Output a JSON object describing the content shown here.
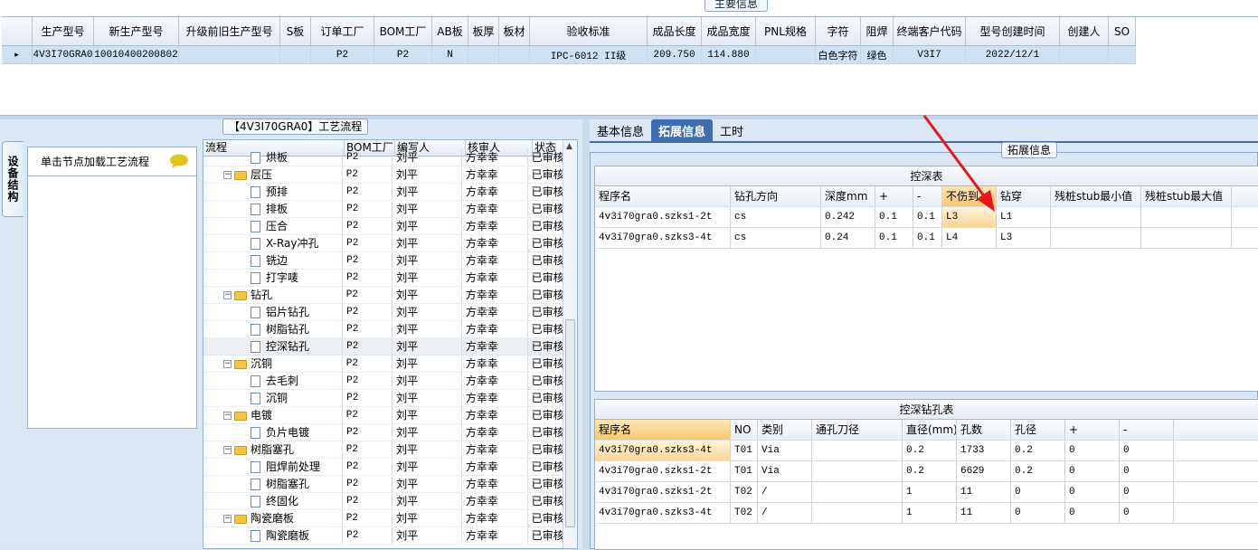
{
  "main_panel": {
    "title": "主要信息",
    "columns": [
      "生产型号",
      "新生产型号",
      "升级前旧生产型号",
      "S板",
      "订单工厂",
      "BOM工厂",
      "AB板",
      "板厚",
      "板材",
      "验收标准",
      "成品长度",
      "成品宽度",
      "PNL规格",
      "字符",
      "阻焊",
      "终端客户代码",
      "型号创建时间",
      "创建人",
      "SO"
    ],
    "row": [
      "4V3I70GRA0",
      "10010400200802",
      "",
      "",
      "P2",
      "P2",
      "N",
      "",
      "",
      "IPC-6012 II级",
      "209.750",
      "114.880",
      "",
      "白色字符",
      "绿色",
      "V3I7",
      "2022/12/1",
      "",
      ""
    ]
  },
  "left_panel": {
    "side_tab": "设备结构",
    "node_hint": "单击节点加载工艺流程",
    "process_title": "【4V3I70GRA0】工艺流程",
    "tree_columns": [
      "流程",
      "BOM工厂",
      "编写人",
      "核审人",
      "状态"
    ],
    "tree_rows": [
      {
        "name": "烘板",
        "level": 2,
        "factory": "P2",
        "writer": "刘平",
        "reviewer": "方幸幸",
        "status": "已审核"
      },
      {
        "name": "层压",
        "level": 1,
        "factory": "P2",
        "writer": "刘平",
        "reviewer": "方幸幸",
        "status": "已审核"
      },
      {
        "name": "预排",
        "level": 2,
        "factory": "P2",
        "writer": "刘平",
        "reviewer": "方幸幸",
        "status": "已审核"
      },
      {
        "name": "排板",
        "level": 2,
        "factory": "P2",
        "writer": "刘平",
        "reviewer": "方幸幸",
        "status": "已审核"
      },
      {
        "name": "压合",
        "level": 2,
        "factory": "P2",
        "writer": "刘平",
        "reviewer": "方幸幸",
        "status": "已审核"
      },
      {
        "name": "X-Ray冲孔",
        "level": 2,
        "factory": "P2",
        "writer": "刘平",
        "reviewer": "方幸幸",
        "status": "已审核"
      },
      {
        "name": "铣边",
        "level": 2,
        "factory": "P2",
        "writer": "刘平",
        "reviewer": "方幸幸",
        "status": "已审核"
      },
      {
        "name": "打字唛",
        "level": 2,
        "factory": "P2",
        "writer": "刘平",
        "reviewer": "方幸幸",
        "status": "已审核"
      },
      {
        "name": "钻孔",
        "level": 1,
        "factory": "P2",
        "writer": "刘平",
        "reviewer": "方幸幸",
        "status": "已审核"
      },
      {
        "name": "铝片钻孔",
        "level": 2,
        "factory": "P2",
        "writer": "刘平",
        "reviewer": "方幸幸",
        "status": "已审核"
      },
      {
        "name": "树脂钻孔",
        "level": 2,
        "factory": "P2",
        "writer": "刘平",
        "reviewer": "方幸幸",
        "status": "已审核"
      },
      {
        "name": "控深钻孔",
        "level": 2,
        "factory": "P2",
        "writer": "刘平",
        "reviewer": "方幸幸",
        "status": "已审核",
        "selected": true
      },
      {
        "name": "沉铜",
        "level": 1,
        "factory": "P2",
        "writer": "刘平",
        "reviewer": "方幸幸",
        "status": "已审核"
      },
      {
        "name": "去毛刺",
        "level": 2,
        "factory": "P2",
        "writer": "刘平",
        "reviewer": "方幸幸",
        "status": "已审核"
      },
      {
        "name": "沉铜",
        "level": 2,
        "factory": "P2",
        "writer": "刘平",
        "reviewer": "方幸幸",
        "status": "已审核"
      },
      {
        "name": "电镀",
        "level": 1,
        "factory": "P2",
        "writer": "刘平",
        "reviewer": "方幸幸",
        "status": "已审核"
      },
      {
        "name": "负片电镀",
        "level": 2,
        "factory": "P2",
        "writer": "刘平",
        "reviewer": "方幸幸",
        "status": "已审核"
      },
      {
        "name": "树脂塞孔",
        "level": 1,
        "factory": "P2",
        "writer": "刘平",
        "reviewer": "方幸幸",
        "status": "已审核"
      },
      {
        "name": "阻焊前处理",
        "level": 2,
        "factory": "P2",
        "writer": "刘平",
        "reviewer": "方幸幸",
        "status": "已审核"
      },
      {
        "name": "树脂塞孔",
        "level": 2,
        "factory": "P2",
        "writer": "刘平",
        "reviewer": "方幸幸",
        "status": "已审核"
      },
      {
        "name": "终固化",
        "level": 2,
        "factory": "P2",
        "writer": "刘平",
        "reviewer": "方幸幸",
        "status": "已审核"
      },
      {
        "name": "陶瓷磨板",
        "level": 1,
        "factory": "P2",
        "writer": "刘平",
        "reviewer": "方幸幸",
        "status": "已审核"
      },
      {
        "name": "陶瓷磨板",
        "level": 2,
        "factory": "P2",
        "writer": "刘平",
        "reviewer": "方幸幸",
        "status": "已审核"
      }
    ]
  },
  "right_panel": {
    "tabs": [
      "基本信息",
      "拓展信息",
      "工时"
    ],
    "active_tab": "拓展信息",
    "ext_title": "拓展信息",
    "depth_table": {
      "caption": "控深表",
      "columns": [
        "程序名",
        "钻孔方向",
        "深度mm",
        "+",
        "-",
        "不伤到",
        "钻穿",
        "残桩stub最小值",
        "残桩stub最大值"
      ],
      "rows": [
        [
          "4v3i70gra0.szks1-2t",
          "cs",
          "0.242",
          "0.1",
          "0.1",
          "L3",
          "L1",
          "",
          ""
        ],
        [
          "4v3i70gra0.szks3-4t",
          "cs",
          "0.24",
          "0.1",
          "0.1",
          "L4",
          "L3",
          "",
          ""
        ]
      ]
    },
    "hole_table": {
      "caption": "控深钻孔表",
      "columns": [
        "程序名",
        "NO",
        "类别",
        "通孔刀径",
        "直径(mm)",
        "孔数",
        "孔径",
        "+",
        "-"
      ],
      "rows": [
        [
          "4v3i70gra0.szks3-4t",
          "T01",
          "Via",
          "",
          "0.2",
          "1733",
          "0.2",
          "0",
          "0"
        ],
        [
          "4v3i70gra0.szks1-2t",
          "T01",
          "Via",
          "",
          "0.2",
          "6629",
          "0.2",
          "0",
          "0"
        ],
        [
          "4v3i70gra0.szks1-2t",
          "T02",
          "/",
          "",
          "1",
          "11",
          "0",
          "0",
          "0"
        ],
        [
          "4v3i70gra0.szks3-4t",
          "T02",
          "/",
          "",
          "1",
          "11",
          "0",
          "0",
          "0"
        ]
      ]
    }
  },
  "colors": {
    "accent": "#3d6fb0",
    "highlight": "#f7c86f",
    "arrow": "#e8161b"
  }
}
